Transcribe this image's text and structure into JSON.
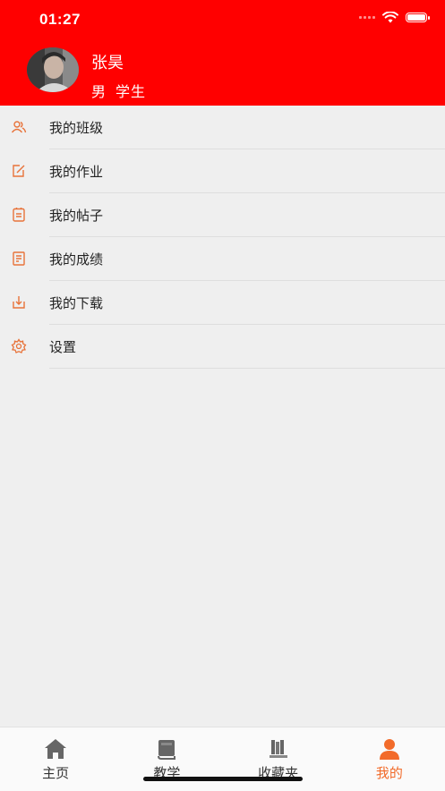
{
  "status_bar": {
    "time": "01:27"
  },
  "profile": {
    "name": "张昊",
    "gender": "男",
    "role": "学生"
  },
  "menu": [
    {
      "label": "我的班级",
      "icon": "users-icon"
    },
    {
      "label": "我的作业",
      "icon": "edit-icon"
    },
    {
      "label": "我的帖子",
      "icon": "document-icon"
    },
    {
      "label": "我的成绩",
      "icon": "report-icon"
    },
    {
      "label": "我的下载",
      "icon": "download-icon"
    },
    {
      "label": "设置",
      "icon": "gear-icon"
    }
  ],
  "tabbar": [
    {
      "label": "主页",
      "icon": "home-icon",
      "active": false
    },
    {
      "label": "教学",
      "icon": "book-icon",
      "active": false
    },
    {
      "label": "收藏夹",
      "icon": "bookshelf-icon",
      "active": false
    },
    {
      "label": "我的",
      "icon": "person-icon",
      "active": true
    }
  ],
  "colors": {
    "header": "#ff0000",
    "accent": "#f26b2a",
    "background": "#efefef"
  }
}
